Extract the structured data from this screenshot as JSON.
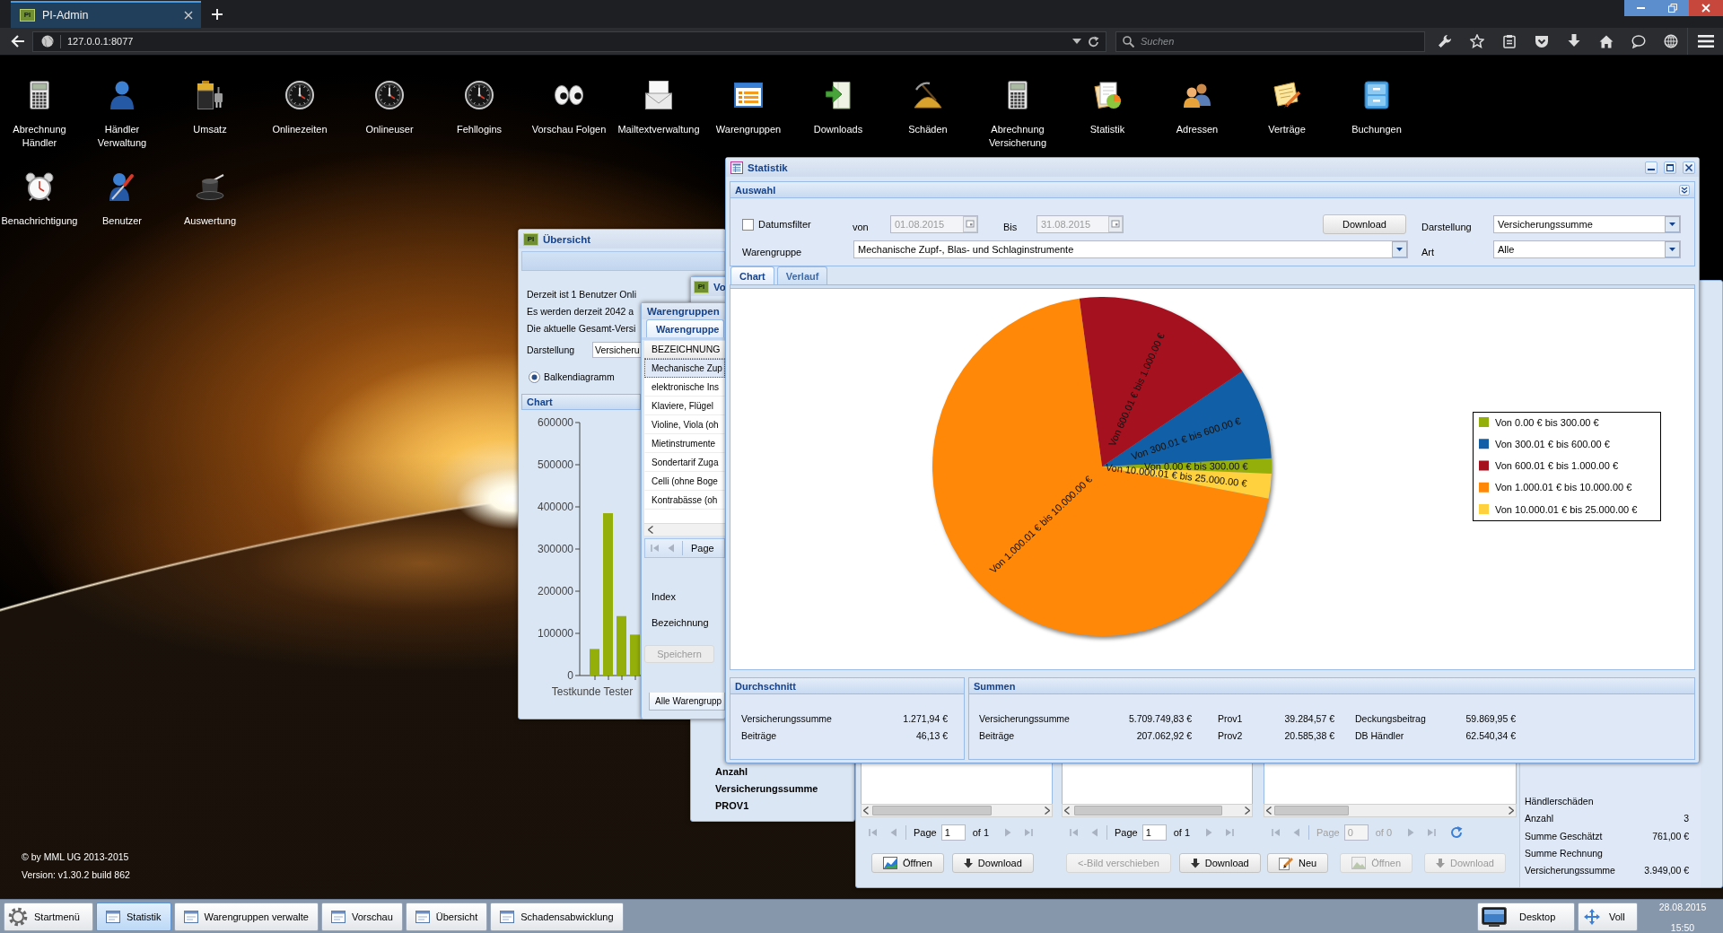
{
  "browser": {
    "tab_logo": "PI",
    "tab_title": "PI-Admin",
    "url": "127.0.0.1:8077",
    "search_placeholder": "Suchen"
  },
  "desktop_icons": [
    {
      "label": "Abrechnung Händler",
      "kind": "calculator"
    },
    {
      "label": "Händler Verwaltung",
      "kind": "person"
    },
    {
      "label": "Umsatz",
      "kind": "battery"
    },
    {
      "label": "Onlinezeiten",
      "kind": "clock"
    },
    {
      "label": "Onlineuser",
      "kind": "clock"
    },
    {
      "label": "Fehllogins",
      "kind": "clock"
    },
    {
      "label": "Vorschau Folgen",
      "kind": "eyes"
    },
    {
      "label": "Mailtextverwaltung",
      "kind": "envelope"
    },
    {
      "label": "Warengruppen",
      "kind": "form"
    },
    {
      "label": "Downloads",
      "kind": "download"
    },
    {
      "label": "Schäden",
      "kind": "pile"
    },
    {
      "label": "Abrechnung Versicherung",
      "kind": "calculator"
    },
    {
      "label": "Statistik",
      "kind": "chart"
    },
    {
      "label": "Adressen",
      "kind": "people"
    },
    {
      "label": "Verträge",
      "kind": "note"
    },
    {
      "label": "Buchungen",
      "kind": "cabinet"
    },
    {
      "label": "Benachrichtigung",
      "kind": "alarm"
    },
    {
      "label": "Benutzer",
      "kind": "tool"
    },
    {
      "label": "Auswertung",
      "kind": "hat"
    }
  ],
  "footer": {
    "copyright": "© by MML UG 2013-2015",
    "version": "Version: v1.30.2 build 862"
  },
  "overview_window": {
    "logo": "PI",
    "title": "Übersicht",
    "lines": [
      "Derzeit ist 1 Benutzer Onli",
      "Es werden derzeit 2042 a",
      "Die aktuelle Gesamt-Versi"
    ],
    "display_label": "Darstellung",
    "display_value": "Versicheru",
    "chart_types": [
      {
        "label": "Balkendiagramm",
        "selected": true
      }
    ],
    "chart_title": "Chart",
    "chart_data": {
      "type": "bar",
      "xlabel": "Testkunde Tester",
      "values": [
        63000,
        385000,
        141000,
        97000
      ],
      "ylim": [
        0,
        600000
      ],
      "yticks": [
        0,
        100000,
        200000,
        300000,
        400000,
        500000,
        600000
      ]
    }
  },
  "preview_window": {
    "logo": "PI",
    "title": "Vo",
    "rows": [
      "Anzahl",
      "Versicherungssumme",
      "PROV1"
    ]
  },
  "product_groups_window": {
    "title": "Warengruppen",
    "tab": {
      "label": "Warengruppe",
      "selected": true
    },
    "column": "BEZEICHNUNG",
    "rows": [
      {
        "label": "Mechanische Zup",
        "selected": true
      },
      {
        "label": "elektronische Ins",
        "selected": false
      },
      {
        "label": "Klaviere, Flügel",
        "selected": false
      },
      {
        "label": "Violine, Viola (oh",
        "selected": false
      },
      {
        "label": "Mietinstrumente",
        "selected": false
      },
      {
        "label": "Sondertarif Zuga",
        "selected": false
      },
      {
        "label": "Celli (ohne Boge",
        "selected": false
      },
      {
        "label": "Kontrabässe (oh",
        "selected": false
      }
    ],
    "page_label": "Page",
    "fields": [
      "Index",
      "Bezeichnung"
    ],
    "save_button": {
      "label": "Speichern",
      "disabled": true
    },
    "bottom_tab": "Alle Warengrupp"
  },
  "statistics_window": {
    "title": "Statistik",
    "filter_panel": {
      "title": "Auswahl",
      "date_filter": {
        "label": "Datumsfilter",
        "checked": false
      },
      "from_label": "von",
      "from_field": {
        "value": "01.08.2015",
        "disabled": true
      },
      "to_label": "Bis",
      "to_field": {
        "value": "31.08.2015",
        "disabled": true
      },
      "download_button": "Download",
      "display_label": "Darstellung",
      "display_value": "Versicherungssumme",
      "group_label": "Warengruppe",
      "group_value": "Mechanische Zupf-, Blas- und Schlaginstrumente",
      "type_label": "Art",
      "type_value": "Alle"
    },
    "tabs": [
      {
        "label": "Chart",
        "selected": true
      },
      {
        "label": "Verlauf",
        "selected": false
      }
    ],
    "slices": [
      {
        "label": "Von 0.00 € bis 300.00 €",
        "color": "#94ae0a"
      },
      {
        "label": "Von 300.01 € bis 600.00 €",
        "color": "#115fa6"
      },
      {
        "label": "Von 600.01 € bis 1.000.00 €",
        "color": "#a61120"
      },
      {
        "label": "Von 1.000.01 € bis 10.000.00 €",
        "color": "#ff8809"
      },
      {
        "label": "Von 10.000.01 € bis 25.000.00 €",
        "color": "#ffd13e"
      }
    ],
    "legend": [
      {
        "label": "Von 0.00 € bis 300.00 €",
        "color": "#94ae0a"
      },
      {
        "label": "Von 300.01 € bis 600.00 €",
        "color": "#115fa6"
      },
      {
        "label": "Von 600.01 € bis 1.000.00 €",
        "color": "#a61120"
      },
      {
        "label": "Von 1.000.01 € bis 10.000.00 €",
        "color": "#ff8809"
      },
      {
        "label": "Von 10.000.01 € bis 25.000.00 €",
        "color": "#ffd13e"
      }
    ],
    "average_panel": {
      "title": "Durchschnitt",
      "rows": [
        {
          "label": "Versicherungssumme",
          "value": "1.271,94 €"
        },
        {
          "label": "Beiträge",
          "value": "46,13 €"
        }
      ]
    },
    "totals_panel": {
      "title": "Summen",
      "rows": [
        [
          {
            "label": "Versicherungssumme",
            "value": "5.709.749,83 €"
          },
          {
            "label": "Prov1",
            "value": "39.284,57 €"
          },
          {
            "label": "Deckungsbeitrag",
            "value": "59.869,95 €"
          }
        ],
        [
          {
            "label": "Beiträge",
            "value": "207.062,92 €"
          },
          {
            "label": "Prov2",
            "value": "20.585,38 €"
          },
          {
            "label": "DB Händler",
            "value": "62.540,34 €"
          }
        ]
      ]
    }
  },
  "claims_window": {
    "sections": [
      {
        "page_label": "Page",
        "page_value": "1",
        "page_total": "of 1",
        "paging_disabled": false,
        "buttons": [
          {
            "label": "Öffnen",
            "kind": "chart",
            "disabled": false
          },
          {
            "label": "Download",
            "kind": "download",
            "disabled": false
          }
        ]
      },
      {
        "page_label": "Page",
        "page_value": "1",
        "page_total": "of 1",
        "paging_disabled": false,
        "buttons": [
          {
            "label": "<-Bild verschieben",
            "kind": "plain",
            "disabled": true
          },
          {
            "label": "Download",
            "kind": "download",
            "disabled": false
          }
        ]
      },
      {
        "page_label": "Page",
        "page_value": "0",
        "page_total": "of 0",
        "paging_disabled": true,
        "refresh": true,
        "buttons": [
          {
            "label": "Neu",
            "kind": "edit",
            "disabled": false
          },
          {
            "label": "Öffnen",
            "kind": "image",
            "disabled": true
          },
          {
            "label": "Download",
            "kind": "download",
            "disabled": true
          }
        ]
      }
    ],
    "summary": [
      {
        "label": "Händlerschäden"
      },
      {
        "label": "Anzahl",
        "value": "3"
      },
      {
        "label": "Summe Geschätzt",
        "value": "761,00 €"
      },
      {
        "label": "Summe Rechnung"
      },
      {
        "label": "Versicherungssumme",
        "value": "3.949,00 €"
      }
    ]
  },
  "taskbar": {
    "start": "Startmenü",
    "items": [
      {
        "label": "Statistik",
        "selected": true
      },
      {
        "label": "Warengruppen verwalte",
        "selected": false
      },
      {
        "label": "Vorschau",
        "selected": false
      },
      {
        "label": "Übersicht",
        "selected": false
      },
      {
        "label": "Schadensabwicklung",
        "selected": false
      }
    ],
    "desktop": "Desktop",
    "fullscreen": "Voll",
    "date": "28.08.2015",
    "time": "15:50"
  }
}
